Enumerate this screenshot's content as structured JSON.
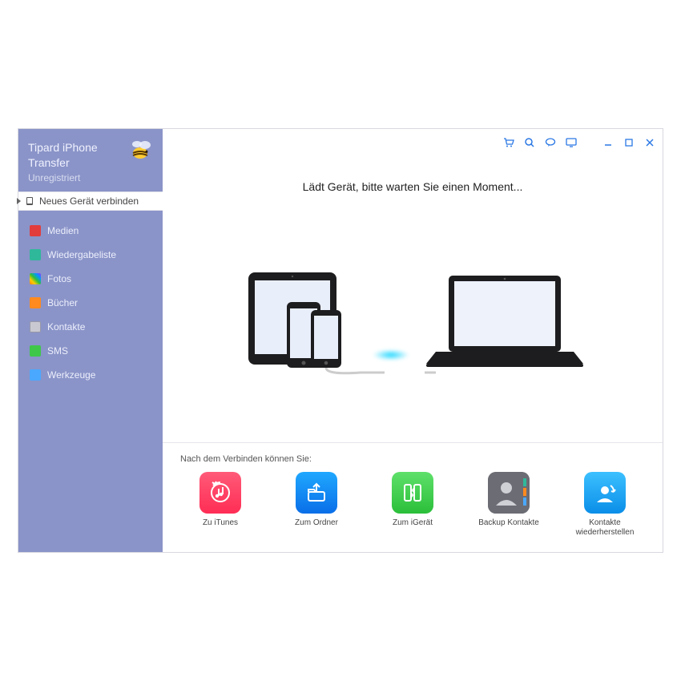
{
  "app": {
    "title_line1": "Tipard iPhone",
    "title_line2": "Transfer",
    "status": "Unregistriert"
  },
  "sidebar": {
    "connect_label": "Neues Gerät verbinden",
    "items": [
      {
        "label": "Medien"
      },
      {
        "label": "Wiedergabeliste"
      },
      {
        "label": "Fotos"
      },
      {
        "label": "Bücher"
      },
      {
        "label": "Kontakte"
      },
      {
        "label": "SMS"
      },
      {
        "label": "Werkzeuge"
      }
    ]
  },
  "main": {
    "loading_text": "Lädt Gerät, bitte warten Sie einen Moment..."
  },
  "bottom": {
    "title": "Nach dem Verbinden können Sie:",
    "actions": [
      {
        "label": "Zu iTunes"
      },
      {
        "label": "Zum Ordner"
      },
      {
        "label": "Zum iGerät"
      },
      {
        "label": "Backup Kontakte"
      },
      {
        "label": "Kontakte wiederherstellen"
      }
    ]
  },
  "titlebar": {
    "icons": [
      "cart-icon",
      "search-icon",
      "message-icon",
      "monitor-icon",
      "minimize-icon",
      "maximize-icon",
      "close-icon"
    ]
  }
}
